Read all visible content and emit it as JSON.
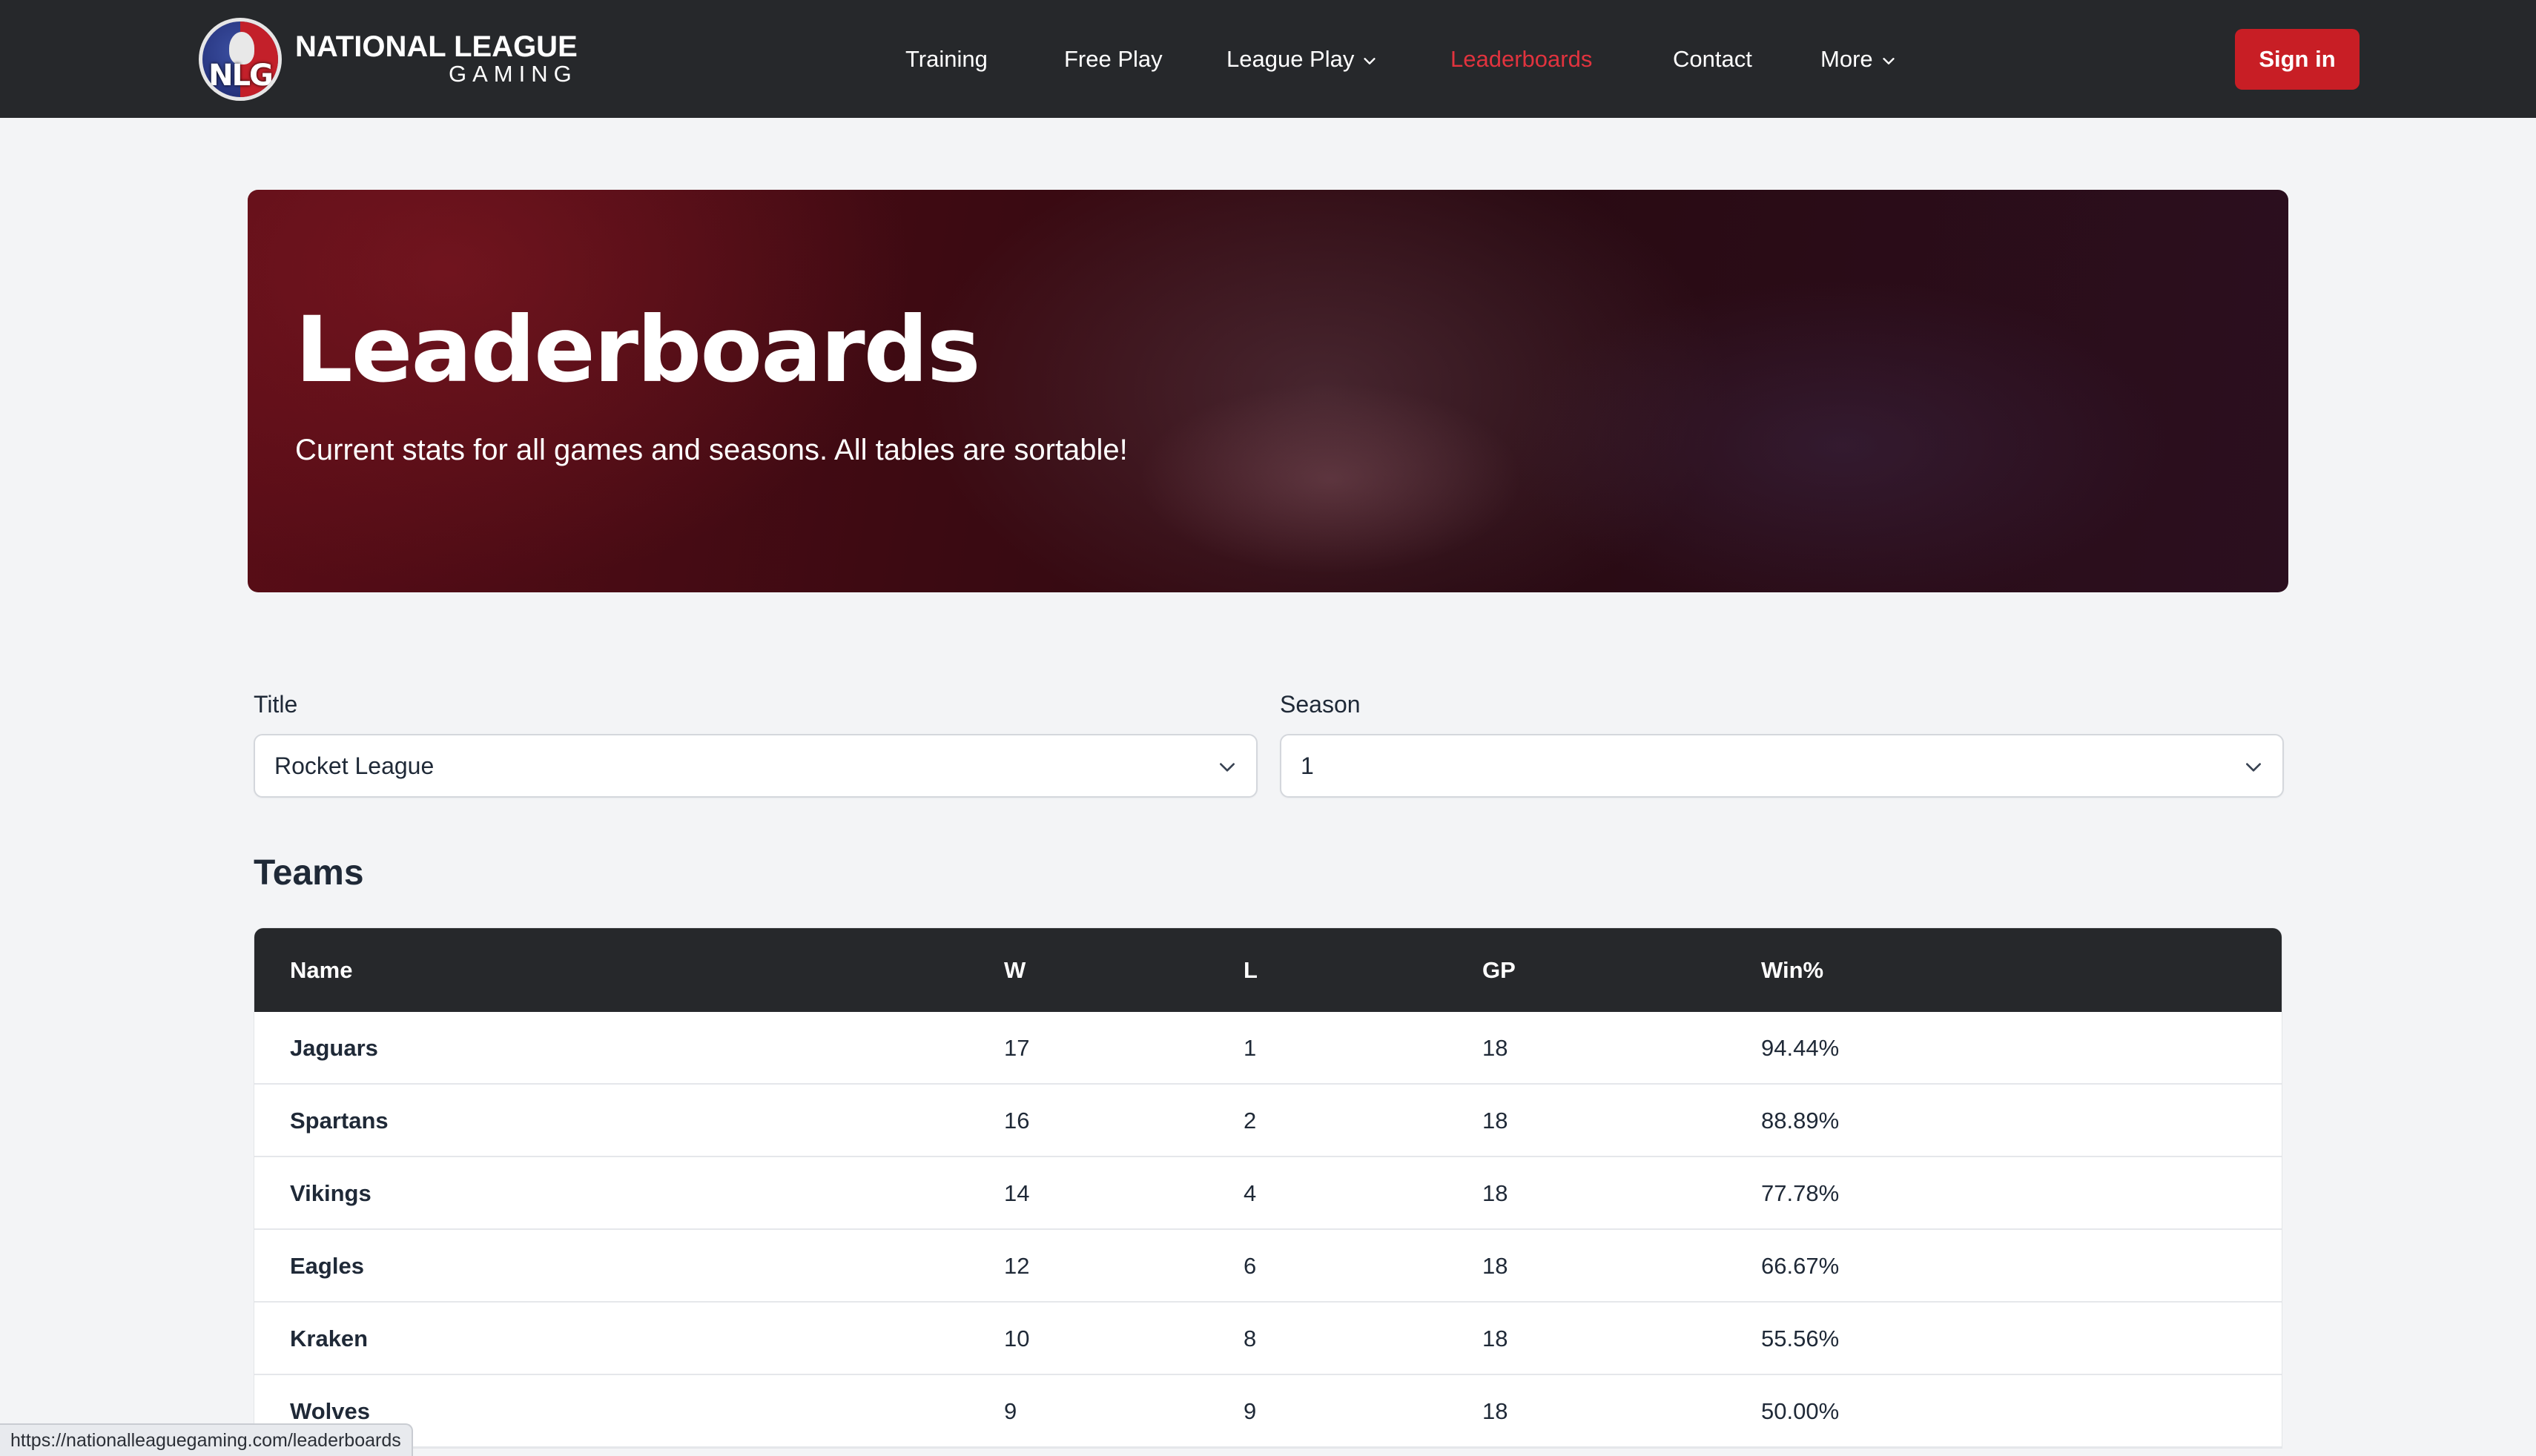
{
  "brand": {
    "badge_text": "NLG",
    "line1": "NATIONAL LEAGUE",
    "line2": "GAMING"
  },
  "nav": {
    "items": [
      {
        "label": "Training"
      },
      {
        "label": "Free Play"
      },
      {
        "label": "League Play",
        "has_dropdown": true
      },
      {
        "label": "Leaderboards",
        "active": true
      },
      {
        "label": "Contact"
      },
      {
        "label": "More",
        "has_dropdown": true
      }
    ],
    "signin_label": "Sign in"
  },
  "hero": {
    "title": "Leaderboards",
    "subtitle": "Current stats for all games and seasons. All tables are sortable!"
  },
  "filters": {
    "title_label": "Title",
    "title_value": "Rocket League",
    "season_label": "Season",
    "season_value": "1"
  },
  "teams": {
    "heading": "Teams",
    "columns": [
      "Name",
      "W",
      "L",
      "GP",
      "Win%"
    ],
    "rows": [
      {
        "name": "Jaguars",
        "w": "17",
        "l": "1",
        "gp": "18",
        "win": "94.44%"
      },
      {
        "name": "Spartans",
        "w": "16",
        "l": "2",
        "gp": "18",
        "win": "88.89%"
      },
      {
        "name": "Vikings",
        "w": "14",
        "l": "4",
        "gp": "18",
        "win": "77.78%"
      },
      {
        "name": "Eagles",
        "w": "12",
        "l": "6",
        "gp": "18",
        "win": "66.67%"
      },
      {
        "name": "Kraken",
        "w": "10",
        "l": "8",
        "gp": "18",
        "win": "55.56%"
      },
      {
        "name": "Wolves",
        "w": "9",
        "l": "9",
        "gp": "18",
        "win": "50.00%"
      }
    ]
  },
  "status_url": "https://nationalleaguegaming.com/leaderboards",
  "colors": {
    "navbar": "#26282b",
    "accent_red": "#c81e25",
    "active_link": "#e1333e",
    "page_bg": "#f3f4f6"
  }
}
